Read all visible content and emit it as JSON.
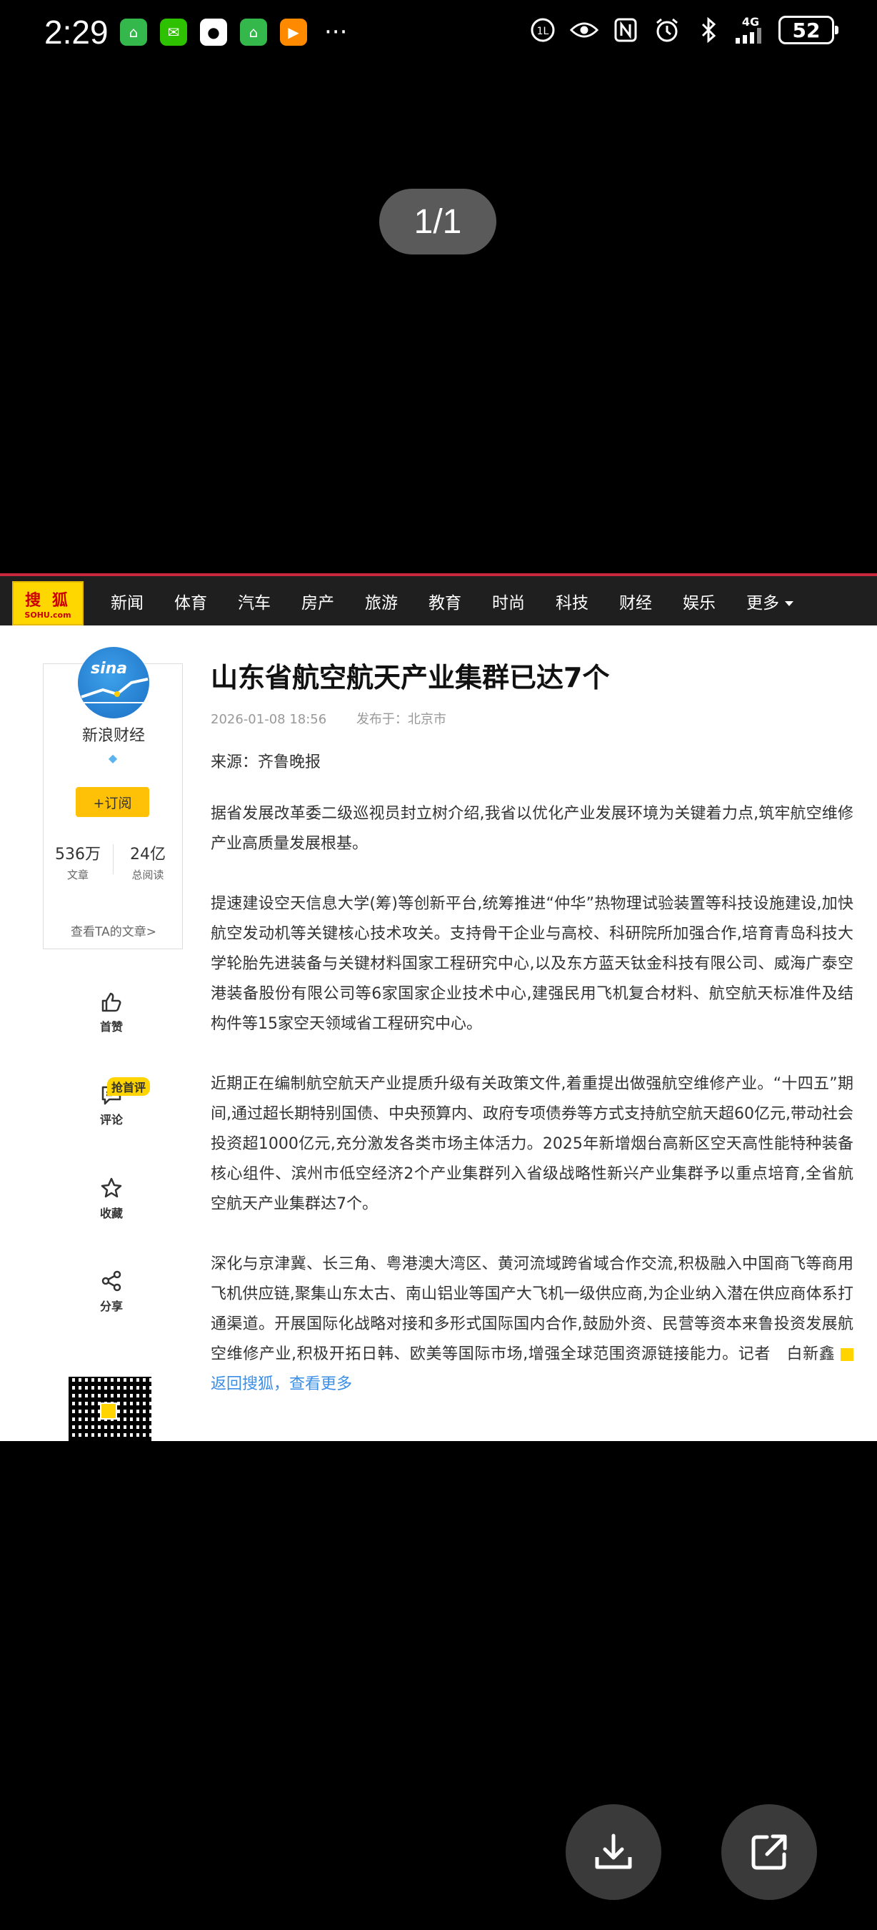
{
  "status_bar": {
    "time": "2:29",
    "network": "4G",
    "battery": "52"
  },
  "viewer": {
    "page_counter": "1/1"
  },
  "site": {
    "logo_cn": "搜 狐",
    "logo_en": "SOHU.com",
    "nav": [
      "新闻",
      "体育",
      "汽车",
      "房产",
      "旅游",
      "教育",
      "时尚",
      "科技",
      "财经",
      "娱乐",
      "更多"
    ]
  },
  "profile": {
    "avatar_text": "sina",
    "name": "新浪财经",
    "subscribe": "+订阅",
    "articles_count": "536万",
    "articles_label": "文章",
    "reads_count": "24亿",
    "reads_label": "总阅读",
    "view_articles": "查看TA的文章>"
  },
  "actions": {
    "like": "首赞",
    "comment": "评论",
    "comment_badge": "抢首评",
    "favorite": "收藏",
    "share": "分享"
  },
  "article": {
    "title": "山东省航空航天产业集群已达7个",
    "date": "2026-01-08 18:56",
    "published_at": "发布于：北京市",
    "source": "来源：齐鲁晚报",
    "paragraphs": [
      "据省发展改革委二级巡视员封立树介绍,我省以优化产业发展环境为关键着力点,筑牢航空维修产业高质量发展根基。",
      "提速建设空天信息大学(筹)等创新平台,统筹推进“仲华”热物理试验装置等科技设施建设,加快航空发动机等关键核心技术攻关。支持骨干企业与高校、科研院所加强合作,培育青岛科技大学轮胎先进装备与关键材料国家工程研究中心,以及东方蓝天钛金科技有限公司、威海广泰空港装备股份有限公司等6家国家企业技术中心,建强民用飞机复合材料、航空航天标准件及结构件等15家空天领域省工程研究中心。",
      "近期正在编制航空航天产业提质升级有关政策文件,着重提出做强航空维修产业。“十四五”期间,通过超长期特别国债、中央预算内、政府专项债券等方式支持航空航天超60亿元,带动社会投资超1000亿元,充分激发各类市场主体活力。2025年新增烟台高新区空天高性能特种装备核心组件、滨州市低空经济2个产业集群列入省级战略性新兴产业集群予以重点培育,全省航空航天产业集群达7个。"
    ],
    "last_paragraph": "深化与京津冀、长三角、粤港澳大湾区、黄河流域跨省域合作交流,积极融入中国商飞等商用飞机供应链,聚集山东太古、南山铝业等国产大飞机一级供应商,为企业纳入潜在供应商体系打通渠道。开展国际化战略对接和多形式国际国内合作,鼓励外资、民营等资本来鲁投资发展航空维修产业,积极开拓日韩、欧美等国际市场,增强全球范围资源链接能力。记者　白新鑫",
    "back_link": "返回搜狐，查看更多"
  },
  "colors": {
    "nav_bg": "#1f1f1f",
    "nav_accent": "#c9283c",
    "logo_bg": "#ffd700",
    "subscribe_bg": "#ffc107",
    "link": "#3a8ee6"
  },
  "icons": [
    "download-icon",
    "share-external-icon",
    "thumbs-up-icon",
    "comment-icon",
    "star-icon",
    "share-icon"
  ]
}
